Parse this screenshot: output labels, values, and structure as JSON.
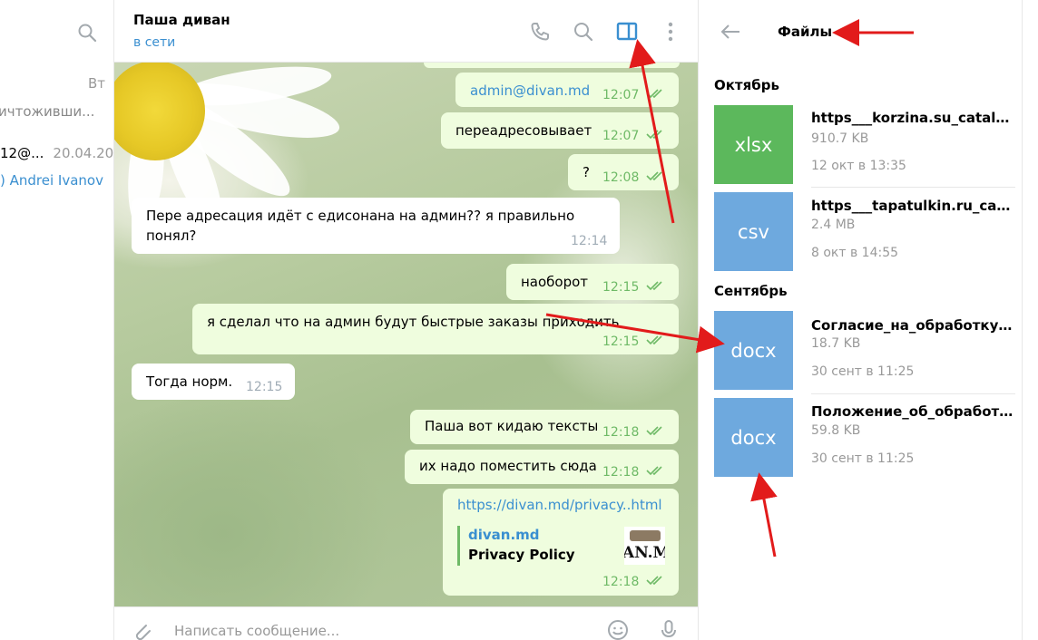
{
  "left_panel": {
    "date_label": "Вт",
    "preview_text": "ичтоживши...",
    "row_title": "12@...",
    "row_date": "20.04.20",
    "row_sender": ") Andrei Ivanov"
  },
  "chat": {
    "contact_name": "Паша диван",
    "status": "в сети",
    "input_placeholder": "Написать сообщение...",
    "messages": [
      {
        "dir": "out",
        "text": "admin@divan.md",
        "time": "12:07"
      },
      {
        "dir": "out",
        "text": "переадресовывает",
        "time": "12:07"
      },
      {
        "dir": "out",
        "text": "?",
        "time": "12:08"
      },
      {
        "dir": "in",
        "text_line1": "Пере адресация идёт с едисонана на админ?? я правильно",
        "text_line2": "понял?",
        "time": "12:14"
      },
      {
        "dir": "out",
        "text": "наоборот",
        "time": "12:15"
      },
      {
        "dir": "out",
        "text": "я сделал что на админ будут быстрые заказы приходить",
        "time": "12:15"
      },
      {
        "dir": "in",
        "text": "Тогда норм.",
        "time": "12:15"
      },
      {
        "dir": "out",
        "text": "Паша вот кидаю тексты",
        "time": "12:18"
      },
      {
        "dir": "out",
        "text": "их надо поместить сюда",
        "time": "12:18"
      },
      {
        "dir": "out",
        "link": "https://divan.md/privacy..html",
        "preview_site": "divan.md",
        "preview_title": "Privacy Policy",
        "preview_thumb_text": "AN.M",
        "time": "12:18"
      }
    ]
  },
  "files_panel": {
    "title": "Файлы",
    "sections": [
      {
        "label": "Октябрь",
        "files": [
          {
            "ext": "xlsx",
            "color": "#5cb85c",
            "name": "https___korzina.su_catalog_...",
            "size": "910.7 KB",
            "date": "12 окт в 13:35"
          },
          {
            "ext": "csv",
            "color": "#6ea9de",
            "name": "https___tapatulkin.ru_catalo...",
            "size": "2.4 MB",
            "date": "8 окт в 14:55"
          }
        ]
      },
      {
        "label": "Сентябрь",
        "files": [
          {
            "ext": "docx",
            "color": "#6ea9de",
            "name": "Согласие_на_обработку_п...",
            "size": "18.7 KB",
            "date": "30 сент в 11:25"
          },
          {
            "ext": "docx",
            "color": "#6ea9de",
            "name": "Положение_об_обработк...",
            "size": "59.8 KB",
            "date": "30 сент в 11:25"
          }
        ]
      }
    ]
  },
  "colors": {
    "accent": "#3a8fd0",
    "outgoing_bubble": "#effdde",
    "check": "#6fba67",
    "annotation_arrow": "#e21b1b"
  }
}
